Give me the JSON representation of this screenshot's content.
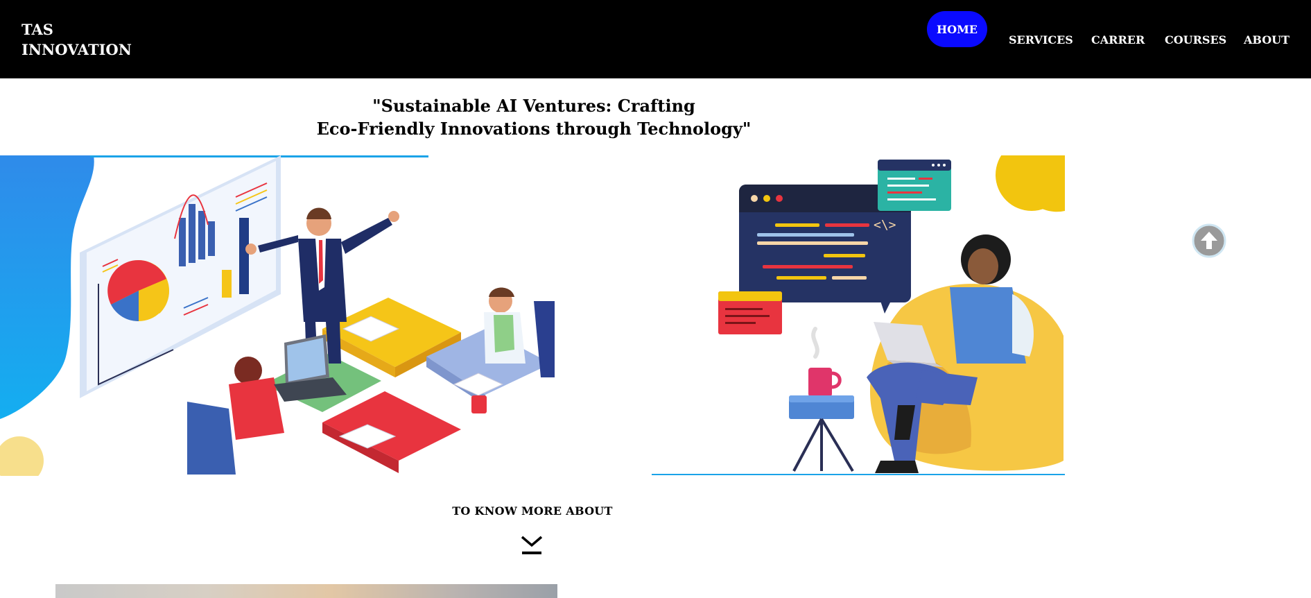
{
  "brand": {
    "line1": "TAS",
    "line2": "INNOVATION"
  },
  "nav": {
    "items": [
      {
        "label": "HOME",
        "active": true
      },
      {
        "label": "SERVICES"
      },
      {
        "label": "CARRER"
      },
      {
        "label": "COURSES"
      },
      {
        "label": "ABOUT"
      }
    ]
  },
  "hero": {
    "title_line1": "\"Sustainable AI Ventures: Crafting",
    "title_line2": "Eco-Friendly Innovations through Technology\""
  },
  "cta": {
    "label": "TO KNOW MORE ABOUT"
  },
  "icons": {
    "scroll_top": "arrow-up-circle-icon",
    "down": "chevron-down-bar-icon"
  },
  "colors": {
    "topbar": "#000000",
    "nav_active": "#0a0aff",
    "accent_blue": "#1e88e5",
    "yellow": "#f5c518",
    "red": "#e8343f",
    "green": "#6bbf73"
  }
}
